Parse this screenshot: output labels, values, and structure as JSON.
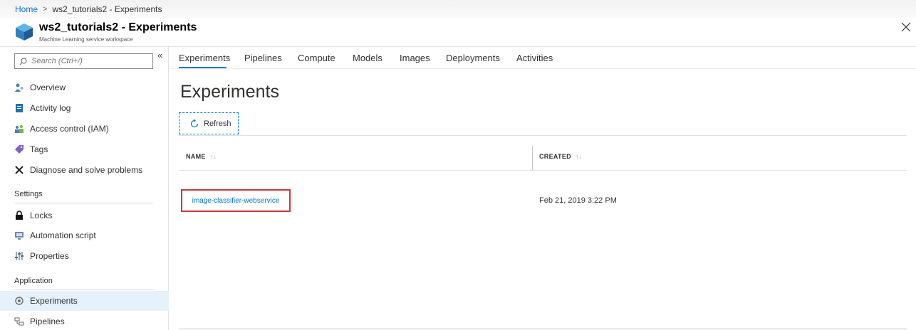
{
  "breadcrumb": {
    "home": "Home",
    "separator": ">",
    "current": "ws2_tutorials2 - Experiments"
  },
  "header": {
    "title": "ws2_tutorials2 - Experiments",
    "subtitle": "Machine Learning service workspace",
    "close_icon": "close-icon"
  },
  "sidebar": {
    "search_placeholder": "Search (Ctrl+/)",
    "collapse": "«",
    "items": [
      {
        "label": "Overview",
        "icon": "overview-icon"
      },
      {
        "label": "Activity log",
        "icon": "activity-log-icon"
      },
      {
        "label": "Access control (IAM)",
        "icon": "iam-icon"
      },
      {
        "label": "Tags",
        "icon": "tag-icon"
      },
      {
        "label": "Diagnose and solve problems",
        "icon": "wrench-icon"
      }
    ],
    "section_settings": "Settings",
    "settings_items": [
      {
        "label": "Locks",
        "icon": "lock-icon"
      },
      {
        "label": "Automation script",
        "icon": "automation-icon"
      },
      {
        "label": "Properties",
        "icon": "properties-icon"
      }
    ],
    "section_application": "Application",
    "application_items": [
      {
        "label": "Experiments",
        "icon": "experiments-icon",
        "active": true
      },
      {
        "label": "Pipelines",
        "icon": "pipelines-icon"
      }
    ]
  },
  "tabs": [
    "Experiments",
    "Pipelines",
    "Compute",
    "Models",
    "Images",
    "Deployments",
    "Activities"
  ],
  "main": {
    "title": "Experiments",
    "refresh_label": "Refresh",
    "columns": {
      "name": "NAME",
      "created": "CREATED",
      "sort_glyph": "↑↓"
    },
    "rows": [
      {
        "name": "image-classifier-webservice",
        "created": "Feb 21, 2019 3:22 PM"
      }
    ]
  },
  "colors": {
    "accent": "#0078d4",
    "highlight_border": "#d13438",
    "active_nav_bg": "#e6f2fb"
  }
}
